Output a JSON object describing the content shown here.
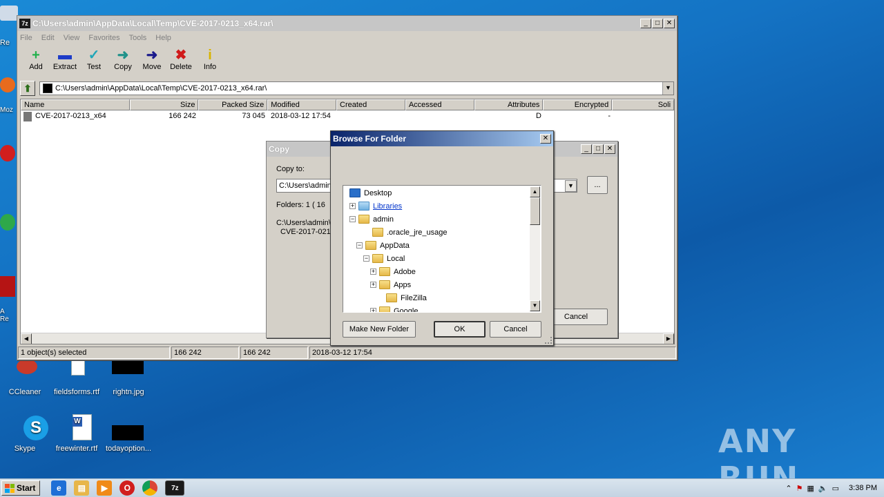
{
  "desktop": {
    "icons": [
      {
        "label": "CCleaner"
      },
      {
        "label": "fieldsforms.rtf"
      },
      {
        "label": "rightn.jpg"
      },
      {
        "label": "Skype"
      },
      {
        "label": "freewinter.rtf"
      },
      {
        "label": "todayoption..."
      }
    ],
    "edge_labels": [
      "Re",
      "Moz",
      "A",
      "Re"
    ],
    "watermark": "ANY RUN"
  },
  "main_window": {
    "title": "C:\\Users\\admin\\AppData\\Local\\Temp\\CVE-2017-0213_x64.rar\\",
    "app_icon": "7z",
    "menu": [
      "File",
      "Edit",
      "View",
      "Favorites",
      "Tools",
      "Help"
    ],
    "toolbar": [
      {
        "label": "Add",
        "icon": "plus-icon",
        "glyph": "+",
        "color": "#22b14c"
      },
      {
        "label": "Extract",
        "icon": "minus-icon",
        "glyph": "▬",
        "color": "#1e3cc8"
      },
      {
        "label": "Test",
        "icon": "check-icon",
        "glyph": "✓",
        "color": "#20a6b8"
      },
      {
        "label": "Copy",
        "icon": "arrow-right-icon",
        "glyph": "➜",
        "color": "#20928a"
      },
      {
        "label": "Move",
        "icon": "arrow-move-icon",
        "glyph": "➜",
        "color": "#1a1a8c"
      },
      {
        "label": "Delete",
        "icon": "x-icon",
        "glyph": "✖",
        "color": "#d01a1a"
      },
      {
        "label": "Info",
        "icon": "info-icon",
        "glyph": "i",
        "color": "#d8b400"
      }
    ],
    "address": "C:\\Users\\admin\\AppData\\Local\\Temp\\CVE-2017-0213_x64.rar\\",
    "columns": [
      "Name",
      "Size",
      "Packed Size",
      "Modified",
      "Created",
      "Accessed",
      "Attributes",
      "Encrypted",
      "Soli"
    ],
    "rows": [
      {
        "name": "CVE-2017-0213_x64",
        "size": "166 242",
        "packed": "73 045",
        "modified": "2018-03-12 17:54",
        "created": "",
        "accessed": "",
        "attributes": "D",
        "encrypted": "-"
      }
    ],
    "status": [
      "1 object(s) selected",
      "166 242",
      "166 242",
      "2018-03-12 17:54"
    ]
  },
  "copy_dialog": {
    "title": "Copy",
    "copy_to_label": "Copy to:",
    "path_value": "C:\\Users\\admin",
    "browse_button": "...",
    "folders_text": "Folders: 1    ( 16",
    "path_line1": "C:\\Users\\admin\\",
    "path_line2": "CVE-2017-0213",
    "cancel": "Cancel"
  },
  "browse_dialog": {
    "title": "Browse For Folder",
    "tree": [
      {
        "label": "Desktop",
        "expander": "",
        "icon": "desktop-icon"
      },
      {
        "label": "Libraries",
        "expander": "+",
        "icon": "libraries-icon"
      },
      {
        "label": "admin",
        "expander": "−",
        "icon": "user-folder-icon"
      },
      {
        "label": ".oracle_jre_usage",
        "expander": "",
        "icon": "folder-icon"
      },
      {
        "label": "AppData",
        "expander": "−",
        "icon": "folder-icon"
      },
      {
        "label": "Local",
        "expander": "−",
        "icon": "folder-icon"
      },
      {
        "label": "Adobe",
        "expander": "+",
        "icon": "folder-icon"
      },
      {
        "label": "Apps",
        "expander": "+",
        "icon": "folder-icon"
      },
      {
        "label": "FileZilla",
        "expander": "",
        "icon": "folder-icon"
      },
      {
        "label": "Google",
        "expander": "+",
        "icon": "folder-icon"
      }
    ],
    "make_new_folder": "Make New Folder",
    "ok": "OK",
    "cancel": "Cancel"
  },
  "taskbar": {
    "start": "Start",
    "time": "3:38 PM"
  }
}
